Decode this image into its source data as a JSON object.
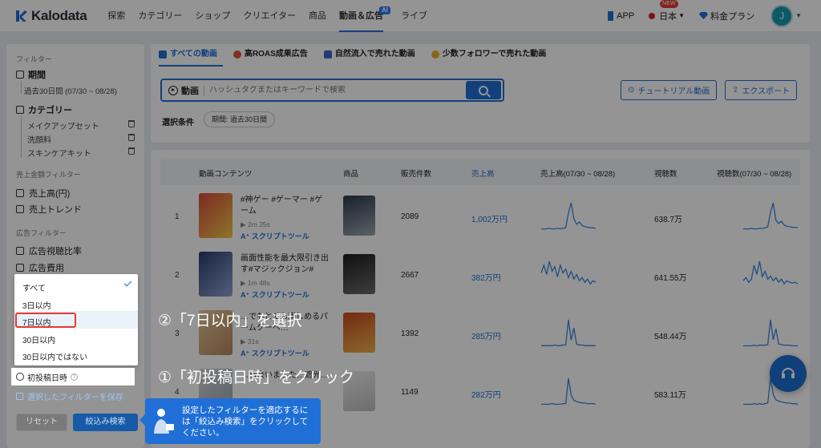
{
  "nav": {
    "brand": "Kalodata",
    "items": [
      "探索",
      "カテゴリー",
      "ショップ",
      "クリエイター",
      "商品",
      "動画＆広告",
      "ライブ"
    ],
    "ai_badge": "AI",
    "app_label": "APP",
    "language_label": "日本",
    "new_badge": "NEW",
    "pricing_label": "料金プラン",
    "avatar_initial": "J"
  },
  "sidebar": {
    "filter_title": "フィルター",
    "period_label": "期間",
    "period_value": "過去30日間 (07/30 ~ 08/28)",
    "category_label": "カテゴリー",
    "categories": [
      "メイクアップセット",
      "洗顔料",
      "スキンケアキット"
    ],
    "sales_filter_title": "売上金額フィルター",
    "sales_revenue": "売上高(円)",
    "sales_trend": "売上トレンド",
    "ad_filter_title": "広告フィルター",
    "ad_view_ratio": "広告視聴比率",
    "ad_cost": "広告費用",
    "save_filter": "選択したフィルターを保存",
    "reset": "リセット",
    "apply": "絞込み検索"
  },
  "dropdown": {
    "options": [
      "すべて",
      "3日以内",
      "7日以内",
      "30日以内",
      "30日以内ではない"
    ],
    "selected": "すべて",
    "first_post_label": "初投稿日時"
  },
  "tabs": [
    "すべての動画",
    "高ROAS成果広告",
    "自然流入で売れた動画",
    "少数フォロワーで売れた動画"
  ],
  "search": {
    "label": "動画",
    "placeholder": "ハッシュタグまたはキーワードで検索"
  },
  "buttons": {
    "tutorial": "チュートリアル動画",
    "export": "エクスポート"
  },
  "conditions": {
    "label": "選択条件",
    "chip": "期間: 過去30日間"
  },
  "table": {
    "headers": [
      "動画コンテンツ",
      "商品",
      "販売件数",
      "売上高",
      "売上高(07/30 ~ 08/28)",
      "視聴数",
      "視聴数(07/30 ~ 08/28)"
    ],
    "script_label": "スクリプトツール",
    "rows": [
      {
        "rank": "1",
        "title": "#神ゲー #ゲーマー #ゲーム",
        "duration": "2m 25s",
        "sales": "2089",
        "revenue": "1,002万円",
        "views": "638.7万",
        "revenue_trend": [
          2,
          2,
          2,
          3,
          2,
          2,
          3,
          2,
          3,
          4,
          30,
          48,
          20,
          10,
          14,
          8,
          6,
          5,
          4,
          4,
          3
        ],
        "views_trend": [
          2,
          2,
          2,
          3,
          2,
          2,
          3,
          3,
          4,
          6,
          32,
          50,
          18,
          12,
          16,
          9,
          7,
          6,
          5,
          5,
          4
        ]
      },
      {
        "rank": "2",
        "title": "画面性能を最大限引き出す#マジックジョン#強…",
        "duration": "1m 48s",
        "sales": "2667",
        "revenue": "382万円",
        "views": "641.55万",
        "revenue_trend": [
          20,
          30,
          18,
          35,
          22,
          28,
          15,
          30,
          20,
          25,
          14,
          22,
          12,
          18,
          10,
          14,
          8,
          12,
          6,
          10,
          8
        ],
        "views_trend": [
          10,
          14,
          8,
          12,
          30,
          18,
          35,
          15,
          22,
          12,
          16,
          10,
          14,
          8,
          12,
          6,
          10,
          8,
          7,
          8,
          6
        ]
      },
      {
        "rank": "3",
        "title": "…でもとても楽しめるパームクーヘ…",
        "duration": "31s",
        "sales": "1392",
        "revenue": "285万円",
        "views": "548.44万",
        "revenue_trend": [
          2,
          2,
          2,
          2,
          2,
          3,
          2,
          2,
          3,
          3,
          40,
          10,
          28,
          4,
          3,
          3,
          2,
          2,
          2,
          2,
          2
        ],
        "views_trend": [
          2,
          2,
          2,
          2,
          3,
          2,
          3,
          3,
          3,
          4,
          45,
          12,
          30,
          5,
          4,
          3,
          3,
          3,
          2,
          2,
          2
        ]
      },
      {
        "rank": "4",
        "title": "…出会いました…遮光…",
        "duration": "",
        "sales": "1149",
        "revenue": "282万円",
        "views": "583.11万",
        "revenue_trend": [
          2,
          2,
          2,
          2,
          3,
          2,
          2,
          2,
          3,
          3,
          42,
          16,
          8,
          6,
          5,
          4,
          4,
          3,
          3,
          3,
          2
        ],
        "views_trend": [
          2,
          2,
          2,
          2,
          3,
          2,
          3,
          2,
          3,
          4,
          44,
          18,
          9,
          7,
          6,
          5,
          4,
          4,
          3,
          3,
          2
        ]
      }
    ]
  },
  "annotations": {
    "step2": "②「7日以内」を選択",
    "step1": "①「初投稿日時」をクリック"
  },
  "tooltip": {
    "text": "設定したフィルターを適応するには「絞込み検索」をクリックしてください。"
  },
  "colors": {
    "accent": "#1f6fd6",
    "highlight_box": "#e53935"
  }
}
